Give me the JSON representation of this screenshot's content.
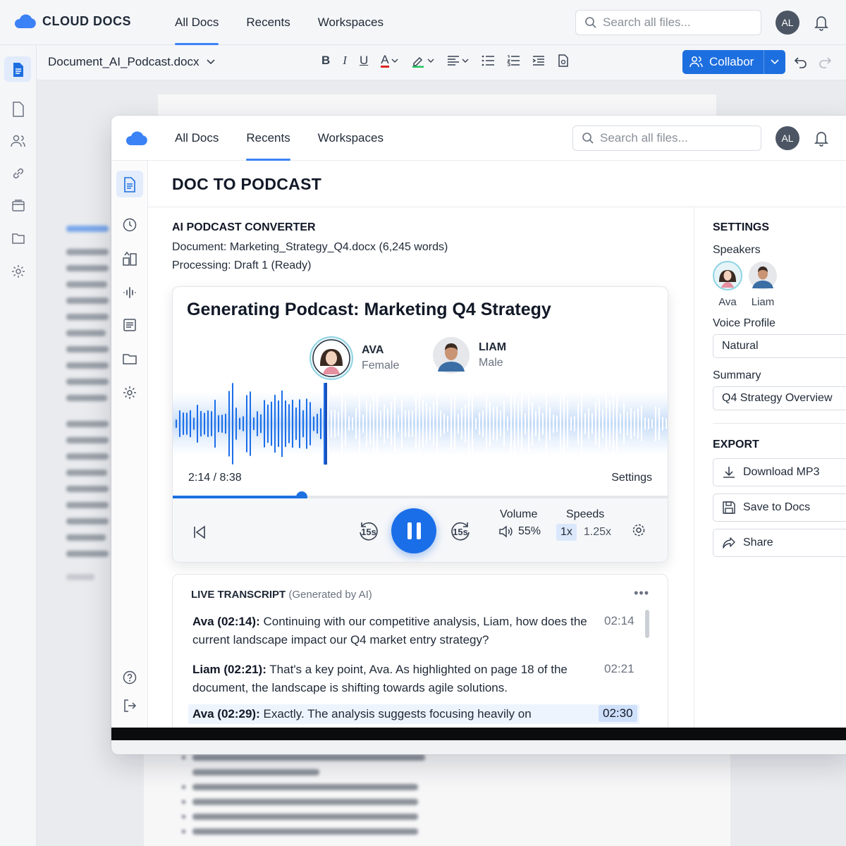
{
  "app": {
    "name": "CLOUD DOCS",
    "nav": [
      {
        "label": "All Docs"
      },
      {
        "label": "Recents"
      },
      {
        "label": "Workspaces"
      }
    ],
    "search_placeholder": "Search all files...",
    "user_initials": "AL",
    "brand_color": "#3b82f6"
  },
  "background_doc": {
    "filename": "Document_AI_Podcast.docx",
    "collab_label": "Collabor"
  },
  "window": {
    "nav": [
      {
        "label": "All Docs"
      },
      {
        "label": "Recents"
      },
      {
        "label": "Workspaces"
      }
    ],
    "search_placeholder": "Search all files...",
    "user_initials": "AL",
    "page_title": "DOC TO PODCAST"
  },
  "converter": {
    "section_title": "AI PODCAST CONVERTER",
    "document_label": "Document:",
    "document_value": "Marketing_Strategy_Q4.docx (6,245 words)",
    "processing_label": "Processing:",
    "processing_value": "Draft 1 (Ready)"
  },
  "player": {
    "title": "Generating Podcast: Marketing Q4 Strategy",
    "speakers": [
      {
        "name": "AVA",
        "gender": "Female",
        "active": true
      },
      {
        "name": "LIAM",
        "gender": "Male",
        "active": false
      }
    ],
    "time": "2:14 / 8:38",
    "progress_fraction": 0.26,
    "settings_label": "Settings",
    "skip_back_label": "15s",
    "skip_fwd_label": "15s",
    "volume_label": "Volume",
    "volume_value": "55%",
    "speeds_label": "Speeds",
    "speed_options": [
      "1x",
      "1.25x"
    ],
    "speed_selected": "1x",
    "accent_color": "#1a6ee8"
  },
  "transcript": {
    "title": "LIVE TRANSCRIPT",
    "subtitle": "(Generated by AI)",
    "entries": [
      {
        "speaker": "Ava (02:14):",
        "text": "Continuing with our competitive analysis, Liam, how does the current landscape impact our Q4 market entry strategy?",
        "ts": "02:14"
      },
      {
        "speaker": "Liam (02:21):",
        "text": "That's a key point, Ava. As highlighted on page 18 of the document, the landscape is shifting towards agile solutions.",
        "ts": "02:21"
      },
      {
        "speaker": "Ava (02:29):",
        "text": "Exactly. The analysis suggests focusing heavily on",
        "ts": "02:30",
        "current": true
      }
    ]
  },
  "settings": {
    "title": "SETTINGS",
    "speakers_label": "Speakers",
    "speakers": [
      {
        "name": "Ava"
      },
      {
        "name": "Liam"
      }
    ],
    "voice_profile_label": "Voice Profile",
    "voice_profile_value": "Natural",
    "summary_label": "Summary",
    "summary_value": "Q4 Strategy Overview",
    "export_title": "EXPORT",
    "export_buttons": [
      {
        "label": "Download MP3",
        "icon": "download-icon"
      },
      {
        "label": "Save to Docs",
        "icon": "save-icon"
      },
      {
        "label": "Share",
        "icon": "share-icon"
      }
    ]
  }
}
